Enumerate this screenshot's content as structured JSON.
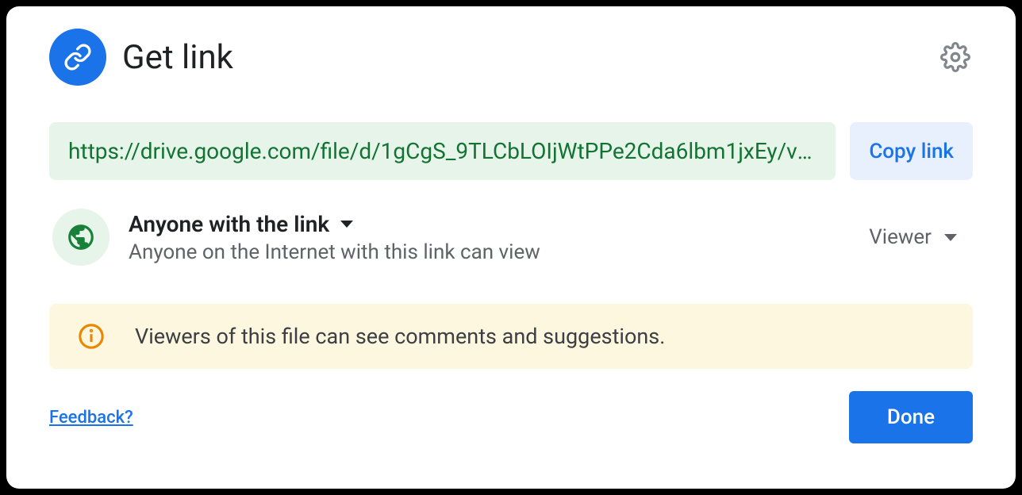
{
  "header": {
    "title": "Get link"
  },
  "link": {
    "url": "https://drive.google.com/file/d/1gCgS_9TLCbLOIjWtPPe2Cda6lbm1jxEy/vi…",
    "copy_label": "Copy link"
  },
  "access": {
    "scope_label": "Anyone with the link",
    "description": "Anyone on the Internet with this link can view",
    "role_label": "Viewer"
  },
  "info": {
    "message": "Viewers of this file can see comments and suggestions."
  },
  "footer": {
    "feedback_label": "Feedback?",
    "done_label": "Done"
  }
}
